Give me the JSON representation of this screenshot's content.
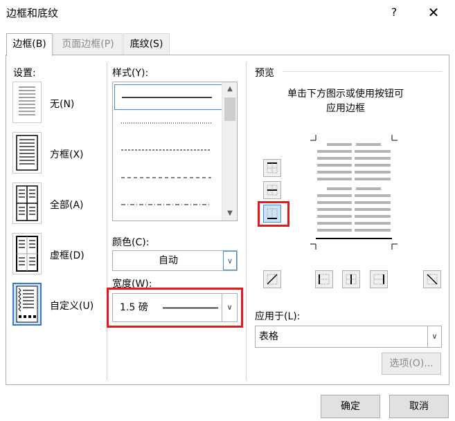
{
  "window": {
    "title": "边框和底纹",
    "help": "?",
    "close": "✕"
  },
  "tabs": [
    {
      "label": "边框(B)"
    },
    {
      "label": "页面边框(P)"
    },
    {
      "label": "底纹(S)"
    }
  ],
  "settings": {
    "heading": "设置:",
    "items": [
      {
        "label": "无(N)"
      },
      {
        "label": "方框(X)"
      },
      {
        "label": "全部(A)"
      },
      {
        "label": "虚框(D)"
      },
      {
        "label": "自定义(U)"
      }
    ]
  },
  "style": {
    "heading": "样式(Y):"
  },
  "color": {
    "heading": "颜色(C):",
    "value": "自动"
  },
  "width": {
    "heading": "宽度(W):",
    "value": "1.5 磅"
  },
  "preview": {
    "heading": "预览",
    "hint_line1": "单击下方图示或使用按钮可",
    "hint_line2": "应用边框"
  },
  "apply_to": {
    "heading": "应用于(L):",
    "value": "表格"
  },
  "buttons": {
    "options": "选项(O)...",
    "ok": "确定",
    "cancel": "取消"
  },
  "colors": {
    "highlight": "#e0191e",
    "selected_bg": "#cde4f7"
  }
}
